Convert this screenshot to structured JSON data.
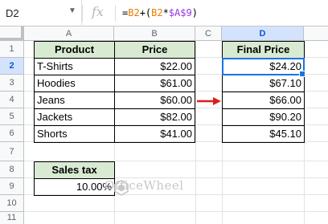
{
  "formula_bar": {
    "name_box": "D2",
    "fx_label": "fx",
    "formula_prefix": "=B2+(B2*$A$9)"
  },
  "columns": [
    "A",
    "B",
    "C",
    "D"
  ],
  "rows": [
    "1",
    "2",
    "3",
    "4",
    "5",
    "6",
    "7",
    "8",
    "9",
    "10",
    "11"
  ],
  "table": {
    "headers": [
      "Product",
      "Price"
    ],
    "rows": [
      [
        "T-Shirts",
        "$22.00"
      ],
      [
        "Hoodies",
        "$61.00"
      ],
      [
        "Jeans",
        "$60.00"
      ],
      [
        "Jackets",
        "$82.00"
      ],
      [
        "Shorts",
        "$41.00"
      ]
    ]
  },
  "final": {
    "header": "Final Price",
    "values": [
      "$24.20",
      "$67.10",
      "$66.00",
      "$90.20",
      "$45.10"
    ]
  },
  "tax": {
    "label": "Sales tax",
    "value": "10.00%"
  },
  "watermark": "OfficeWheel",
  "colors": {
    "header_fill": "#d9ead3",
    "selection": "#1a73e8",
    "arrow": "#e01b1b"
  }
}
